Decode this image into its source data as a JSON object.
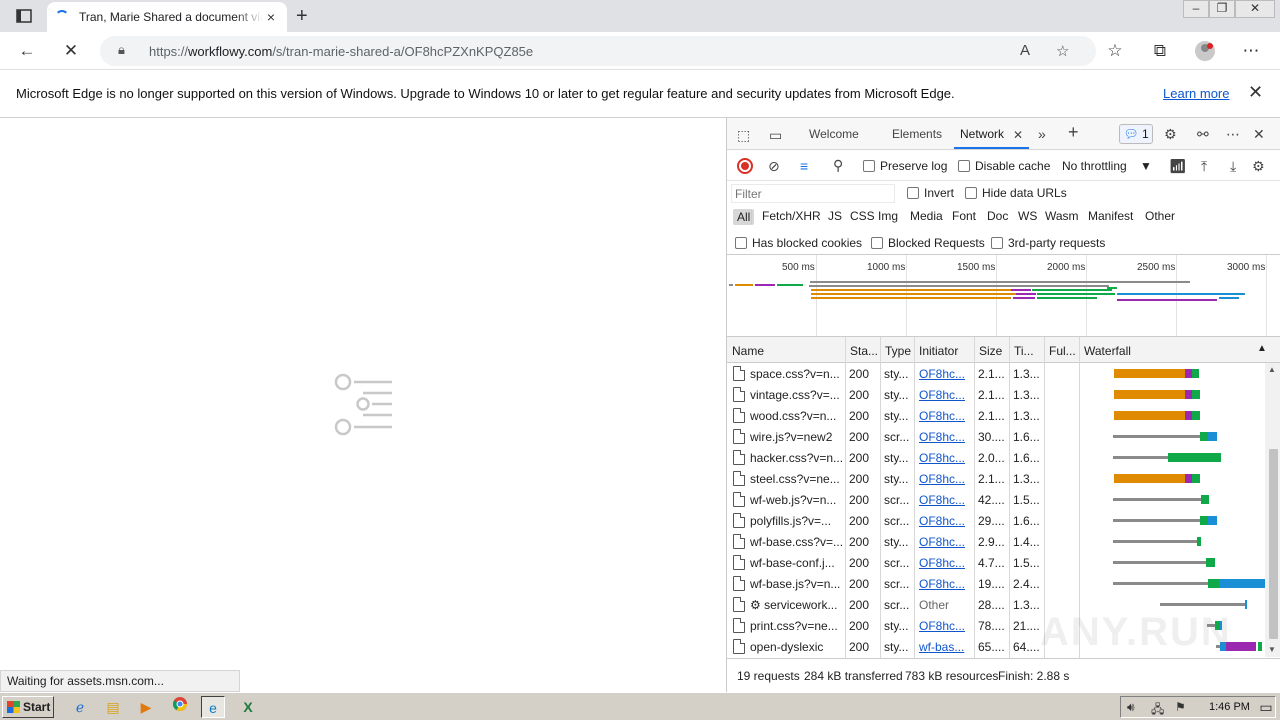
{
  "browser": {
    "tab_title": "Tran, Marie Shared a document via WorkFlowy",
    "url_prefix": "https://",
    "url_domain": "workflowy.com",
    "url_path": "/s/tran-marie-shared-a/OF8hcPZXnKPQZ85e",
    "new_tab": "+",
    "close_tab": "×"
  },
  "infobar": {
    "message": "Microsoft Edge is no longer supported on this version of Windows. Upgrade to Windows 10 or later to get regular feature and security updates from Microsoft Edge.",
    "learn_more": "Learn more"
  },
  "status_text": "Waiting for assets.msn.com...",
  "devtools": {
    "tabs": [
      "Welcome",
      "Elements",
      "Network"
    ],
    "active_tab": "Network",
    "issues_count": "1",
    "toolbar": {
      "preserve_log": "Preserve log",
      "disable_cache": "Disable cache",
      "throttling": "No throttling"
    },
    "filter": {
      "placeholder": "Filter",
      "invert": "Invert",
      "hide_data_urls": "Hide data URLs"
    },
    "types": [
      "All",
      "Fetch/XHR",
      "JS",
      "CSS",
      "Img",
      "Media",
      "Font",
      "Doc",
      "WS",
      "Wasm",
      "Manifest",
      "Other"
    ],
    "blocked": {
      "has_blocked_cookies": "Has blocked cookies",
      "blocked_requests": "Blocked Requests",
      "third_party": "3rd-party requests"
    },
    "overview_ticks": [
      "500 ms",
      "1000 ms",
      "1500 ms",
      "2000 ms",
      "2500 ms",
      "3000 ms"
    ],
    "columns": {
      "name": "Name",
      "status": "Sta...",
      "type": "Type",
      "initiator": "Initiator",
      "size": "Size",
      "time": "Ti...",
      "fulfilled": "Ful...",
      "waterfall": "Waterfall"
    },
    "rows": [
      {
        "name": "space.css?v=n...",
        "status": "200",
        "type": "sty...",
        "initiator": "OF8hc...",
        "size": "2.1...",
        "time": "1.3...",
        "link": true
      },
      {
        "name": "vintage.css?v=...",
        "status": "200",
        "type": "sty...",
        "initiator": "OF8hc...",
        "size": "2.1...",
        "time": "1.3...",
        "link": true
      },
      {
        "name": "wood.css?v=n...",
        "status": "200",
        "type": "sty...",
        "initiator": "OF8hc...",
        "size": "2.1...",
        "time": "1.3...",
        "link": true
      },
      {
        "name": "wire.js?v=new2",
        "status": "200",
        "type": "scr...",
        "initiator": "OF8hc...",
        "size": "30....",
        "time": "1.6...",
        "link": true
      },
      {
        "name": "hacker.css?v=n...",
        "status": "200",
        "type": "sty...",
        "initiator": "OF8hc...",
        "size": "2.0...",
        "time": "1.6...",
        "link": true
      },
      {
        "name": "steel.css?v=ne...",
        "status": "200",
        "type": "sty...",
        "initiator": "OF8hc...",
        "size": "2.1...",
        "time": "1.3...",
        "link": true
      },
      {
        "name": "wf-web.js?v=n...",
        "status": "200",
        "type": "scr...",
        "initiator": "OF8hc...",
        "size": "42....",
        "time": "1.5...",
        "link": true
      },
      {
        "name": "polyfills.js?v=...",
        "status": "200",
        "type": "scr...",
        "initiator": "OF8hc...",
        "size": "29....",
        "time": "1.6...",
        "link": true
      },
      {
        "name": "wf-base.css?v=...",
        "status": "200",
        "type": "sty...",
        "initiator": "OF8hc...",
        "size": "2.9...",
        "time": "1.4...",
        "link": true
      },
      {
        "name": "wf-base-conf.j...",
        "status": "200",
        "type": "scr...",
        "initiator": "OF8hc...",
        "size": "4.7...",
        "time": "1.5...",
        "link": true
      },
      {
        "name": "wf-base.js?v=n...",
        "status": "200",
        "type": "scr...",
        "initiator": "OF8hc...",
        "size": "19....",
        "time": "2.4...",
        "link": true
      },
      {
        "name": "⚙ servicework...",
        "status": "200",
        "type": "scr...",
        "initiator": "Other",
        "size": "28....",
        "time": "1.3...",
        "link": false
      },
      {
        "name": "print.css?v=ne...",
        "status": "200",
        "type": "sty...",
        "initiator": "OF8hc...",
        "size": "78....",
        "time": "21....",
        "link": true
      },
      {
        "name": "open-dyslexic",
        "status": "200",
        "type": "sty...",
        "initiator": "wf-bas...",
        "size": "65....",
        "time": "64....",
        "link": true
      }
    ],
    "summary": {
      "requests": "19 requests",
      "transferred": "284 kB transferred",
      "resources": "783 kB resources",
      "finish": "Finish: 2.88 s"
    }
  },
  "watermark": "ANY.RUN",
  "taskbar": {
    "start": "Start",
    "clock": "1:46 PM"
  },
  "colors": {
    "waiting": "#8a8a8a",
    "stylesheet": "#e08a00",
    "stall": "#9c27b0",
    "download": "#0fa94a",
    "script": "#1a8fd6",
    "accent": "#1a73e8"
  }
}
